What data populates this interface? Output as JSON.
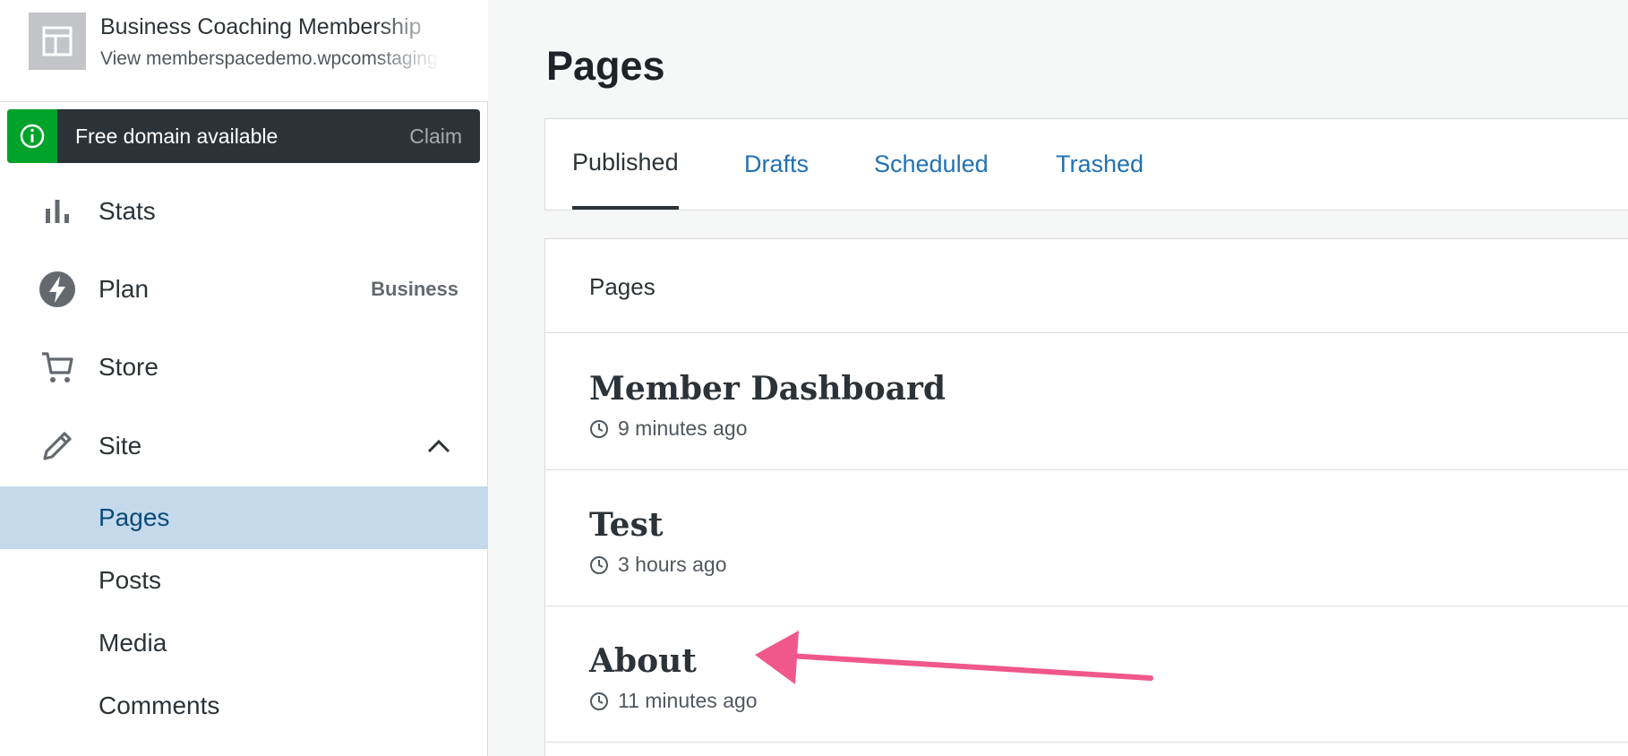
{
  "sidebar": {
    "site": {
      "title": "Business Coaching Membership",
      "url": "View memberspacedemo.wpcomstaging.com"
    },
    "notice": {
      "text": "Free domain available",
      "action": "Claim",
      "color": "#00a32a"
    },
    "menu": [
      {
        "label": "Stats",
        "icon": "stats-icon"
      },
      {
        "label": "Plan",
        "icon": "plan-icon",
        "badge": "Business"
      },
      {
        "label": "Store",
        "icon": "cart-icon"
      },
      {
        "label": "Site",
        "icon": "pencil-icon",
        "expanded": true
      }
    ],
    "submenu": [
      {
        "label": "Pages",
        "active": true
      },
      {
        "label": "Posts"
      },
      {
        "label": "Media"
      },
      {
        "label": "Comments"
      }
    ]
  },
  "main": {
    "title": "Pages",
    "tabs": [
      {
        "label": "Published",
        "active": true
      },
      {
        "label": "Drafts"
      },
      {
        "label": "Scheduled"
      },
      {
        "label": "Trashed"
      }
    ],
    "list": {
      "header": "Pages",
      "rows": [
        {
          "title": "Member Dashboard",
          "time": "9 minutes ago"
        },
        {
          "title": "Test",
          "time": "3 hours ago"
        },
        {
          "title": "About",
          "time": "11 minutes ago"
        }
      ]
    }
  },
  "annotation": {
    "arrow_color": "#f0578a"
  }
}
